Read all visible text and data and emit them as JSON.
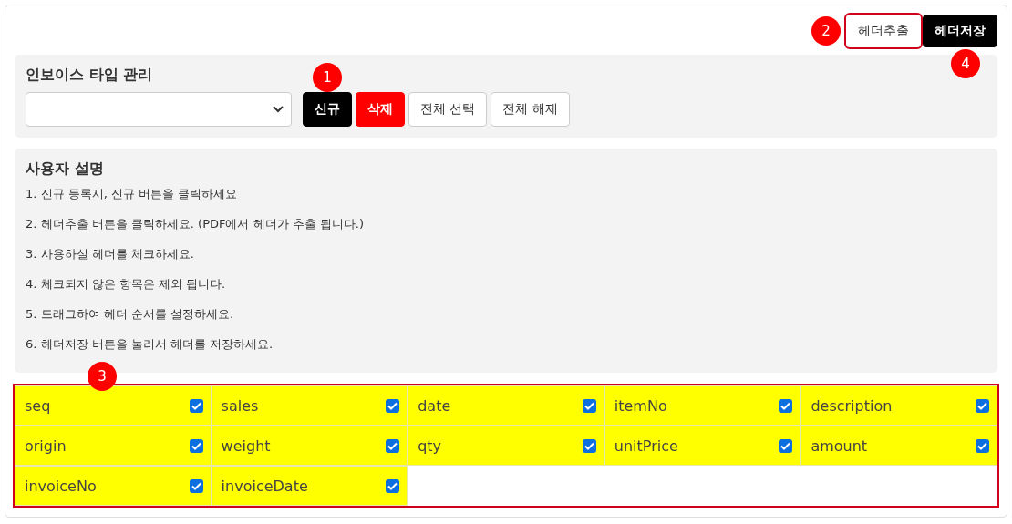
{
  "header_buttons": [
    {
      "label": "헤더추출",
      "kind": "default",
      "highlighted": true,
      "badge": "2"
    },
    {
      "label": "헤더저장",
      "kind": "primary",
      "highlighted": false,
      "badge": "4"
    }
  ],
  "invoice_type": {
    "title": "인보이스 타입 관리",
    "buttons": [
      {
        "label": "신규",
        "kind": "primary",
        "badge": "1"
      },
      {
        "label": "삭제",
        "kind": "danger"
      },
      {
        "label": "전체 선택",
        "kind": "default"
      },
      {
        "label": "전체 해제",
        "kind": "default"
      }
    ]
  },
  "guide": {
    "title": "사용자 설명",
    "steps": [
      "1. 신규 등록시, 신규 버튼을 클릭하세요",
      "2. 헤더추출 버튼을 클릭하세요. (PDF에서 헤더가 추출 됩니다.)",
      "3. 사용하실 헤더를 체크하세요.",
      "4. 체크되지 않은 항목은 제외 됩니다.",
      "5. 드래그하여 헤더 순서를 설정하세요.",
      "6. 헤더저장 버튼을 눌러서 헤더를 저장하세요."
    ]
  },
  "header_grid": {
    "highlighted": true,
    "badge": "3",
    "headers": [
      {
        "label": "seq",
        "checked": true
      },
      {
        "label": "sales",
        "checked": true
      },
      {
        "label": "date",
        "checked": true
      },
      {
        "label": "itemNo",
        "checked": true
      },
      {
        "label": "description",
        "checked": true
      },
      {
        "label": "origin",
        "checked": true
      },
      {
        "label": "weight",
        "checked": true
      },
      {
        "label": "qty",
        "checked": true
      },
      {
        "label": "unitPrice",
        "checked": true
      },
      {
        "label": "amount",
        "checked": true
      },
      {
        "label": "invoiceNo",
        "checked": true
      },
      {
        "label": "invoiceDate",
        "checked": true
      }
    ]
  }
}
